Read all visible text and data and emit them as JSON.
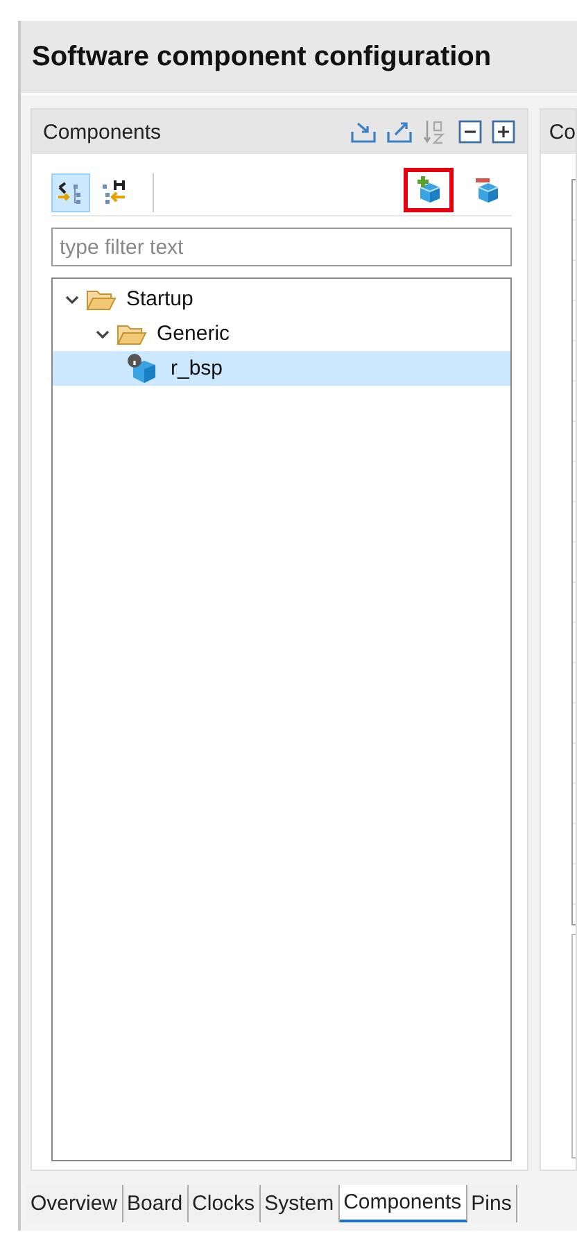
{
  "title": "Software component configuration",
  "components_panel": {
    "title": "Components",
    "view_toggles": [
      {
        "kind": "c-tree",
        "selected": true
      },
      {
        "kind": "h-tree",
        "selected": false
      }
    ],
    "actions": [
      {
        "kind": "add",
        "highlighted": true
      },
      {
        "kind": "remove",
        "highlighted": false
      }
    ],
    "filter": {
      "placeholder": "type filter text"
    },
    "tree": [
      {
        "label": "Startup",
        "kind": "folder",
        "expanded": true,
        "selected": false,
        "children": [
          {
            "label": "Generic",
            "kind": "folder",
            "expanded": true,
            "selected": false,
            "children": [
              {
                "label": "r_bsp",
                "kind": "component",
                "selected": true
              }
            ]
          }
        ]
      }
    ]
  },
  "side_panel": {
    "title": "Co"
  },
  "tabs": [
    {
      "label": "Overview",
      "selected": false
    },
    {
      "label": "Board",
      "selected": false
    },
    {
      "label": "Clocks",
      "selected": false
    },
    {
      "label": "System",
      "selected": false
    },
    {
      "label": "Components",
      "selected": true
    },
    {
      "label": "Pins",
      "selected": false
    }
  ]
}
